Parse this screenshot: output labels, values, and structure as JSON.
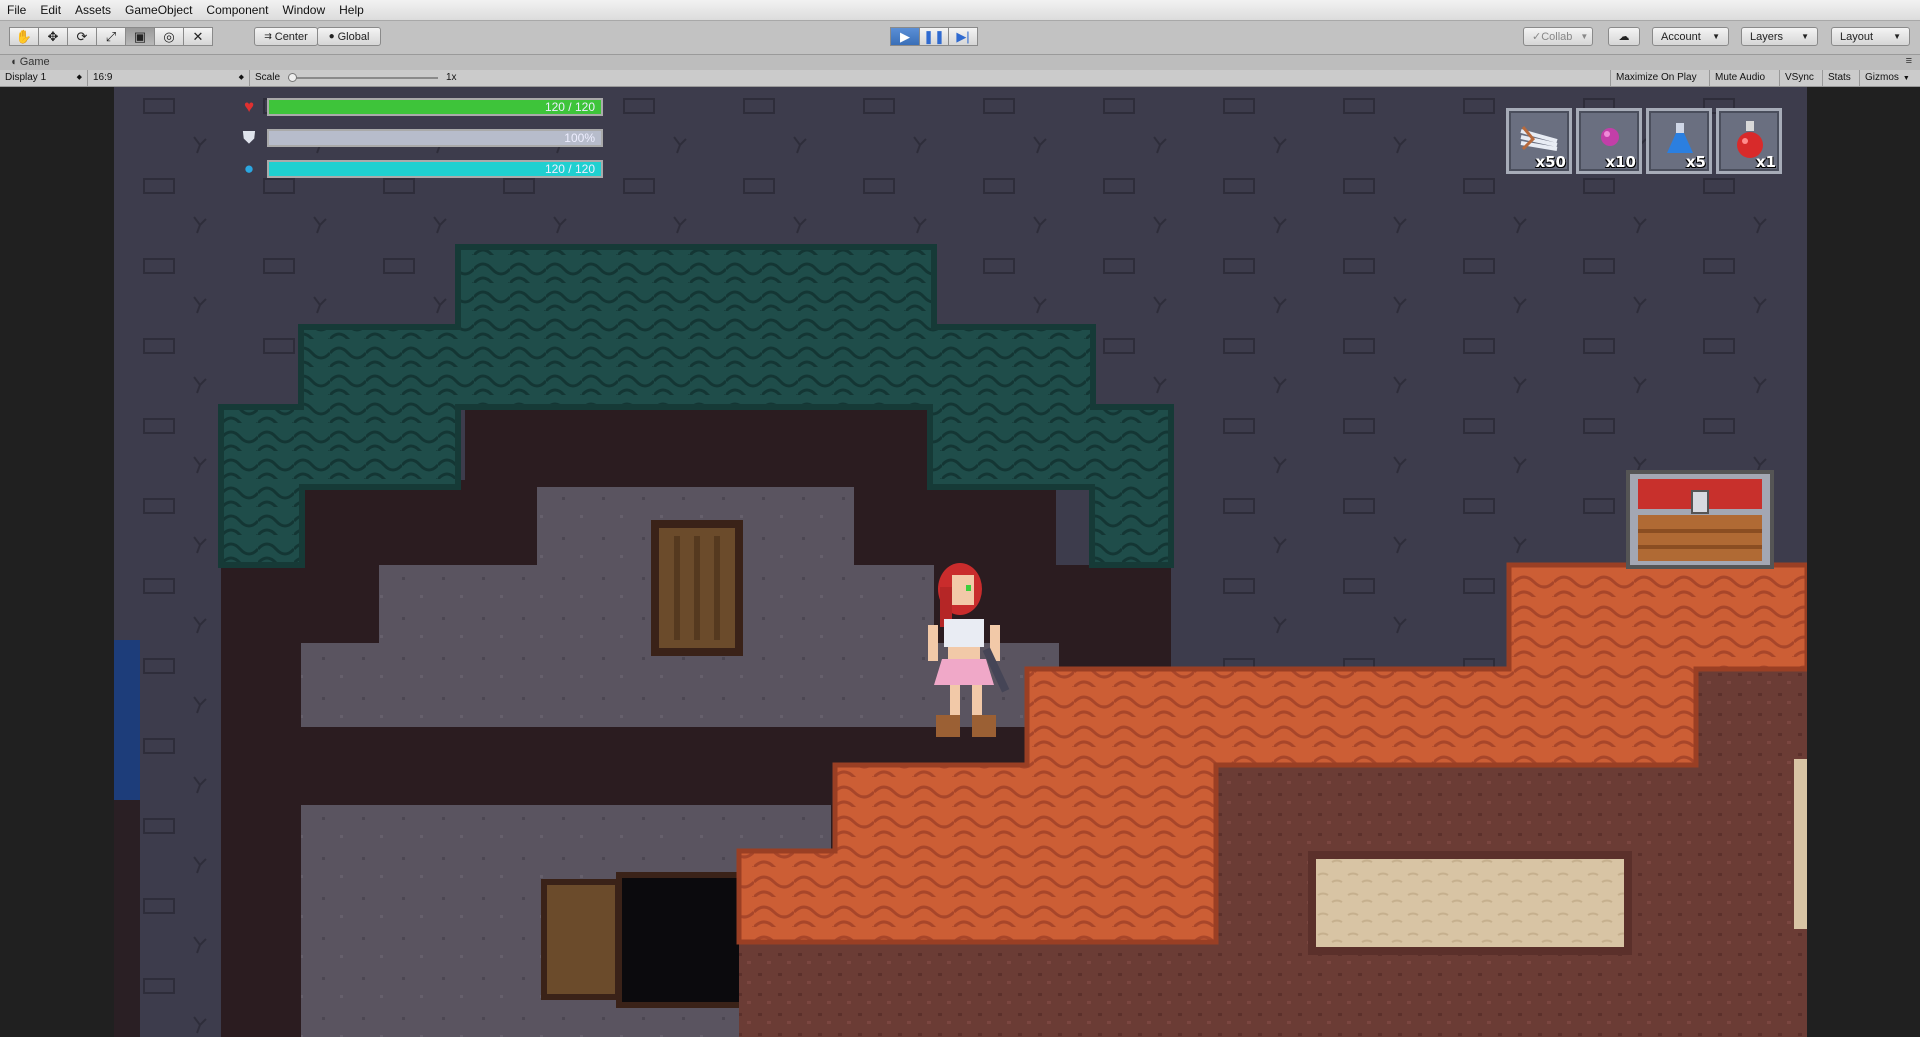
{
  "menu": [
    "File",
    "Edit",
    "Assets",
    "GameObject",
    "Component",
    "Window",
    "Help"
  ],
  "toolbar": {
    "tools": [
      "hand-tool",
      "move-tool",
      "rotate-tool",
      "scale-tool",
      "rect-tool",
      "transform-tool",
      "custom-tool"
    ],
    "pivot_label": "Center",
    "space_label": "Global",
    "collab_label": "Collab",
    "account_label": "Account",
    "layers_label": "Layers",
    "layout_label": "Layout"
  },
  "game_tab": {
    "title": "Game"
  },
  "game_bar": {
    "display": "Display 1",
    "aspect": "16:9",
    "scale_label": "Scale",
    "scale_value": "1x",
    "maximize": "Maximize On Play",
    "mute": "Mute Audio",
    "vsync": "VSync",
    "stats": "Stats",
    "gizmos": "Gizmos"
  },
  "hud": {
    "health_text": "120 / 120",
    "health_fraction": 1.0,
    "armor_text": "100%",
    "armor_fraction": 1.0,
    "mana_text": "120 / 120",
    "mana_fraction": 1.0,
    "colors": {
      "health": "#3ec43a",
      "armor": "#b7bccb",
      "mana": "#1fd0d0"
    }
  },
  "inventory": [
    {
      "icon": "arrows-icon",
      "count": "x50"
    },
    {
      "icon": "gem-icon",
      "count": "x10"
    },
    {
      "icon": "mana-potion-icon",
      "count": "x5"
    },
    {
      "icon": "health-potion-icon",
      "count": "x1"
    }
  ]
}
